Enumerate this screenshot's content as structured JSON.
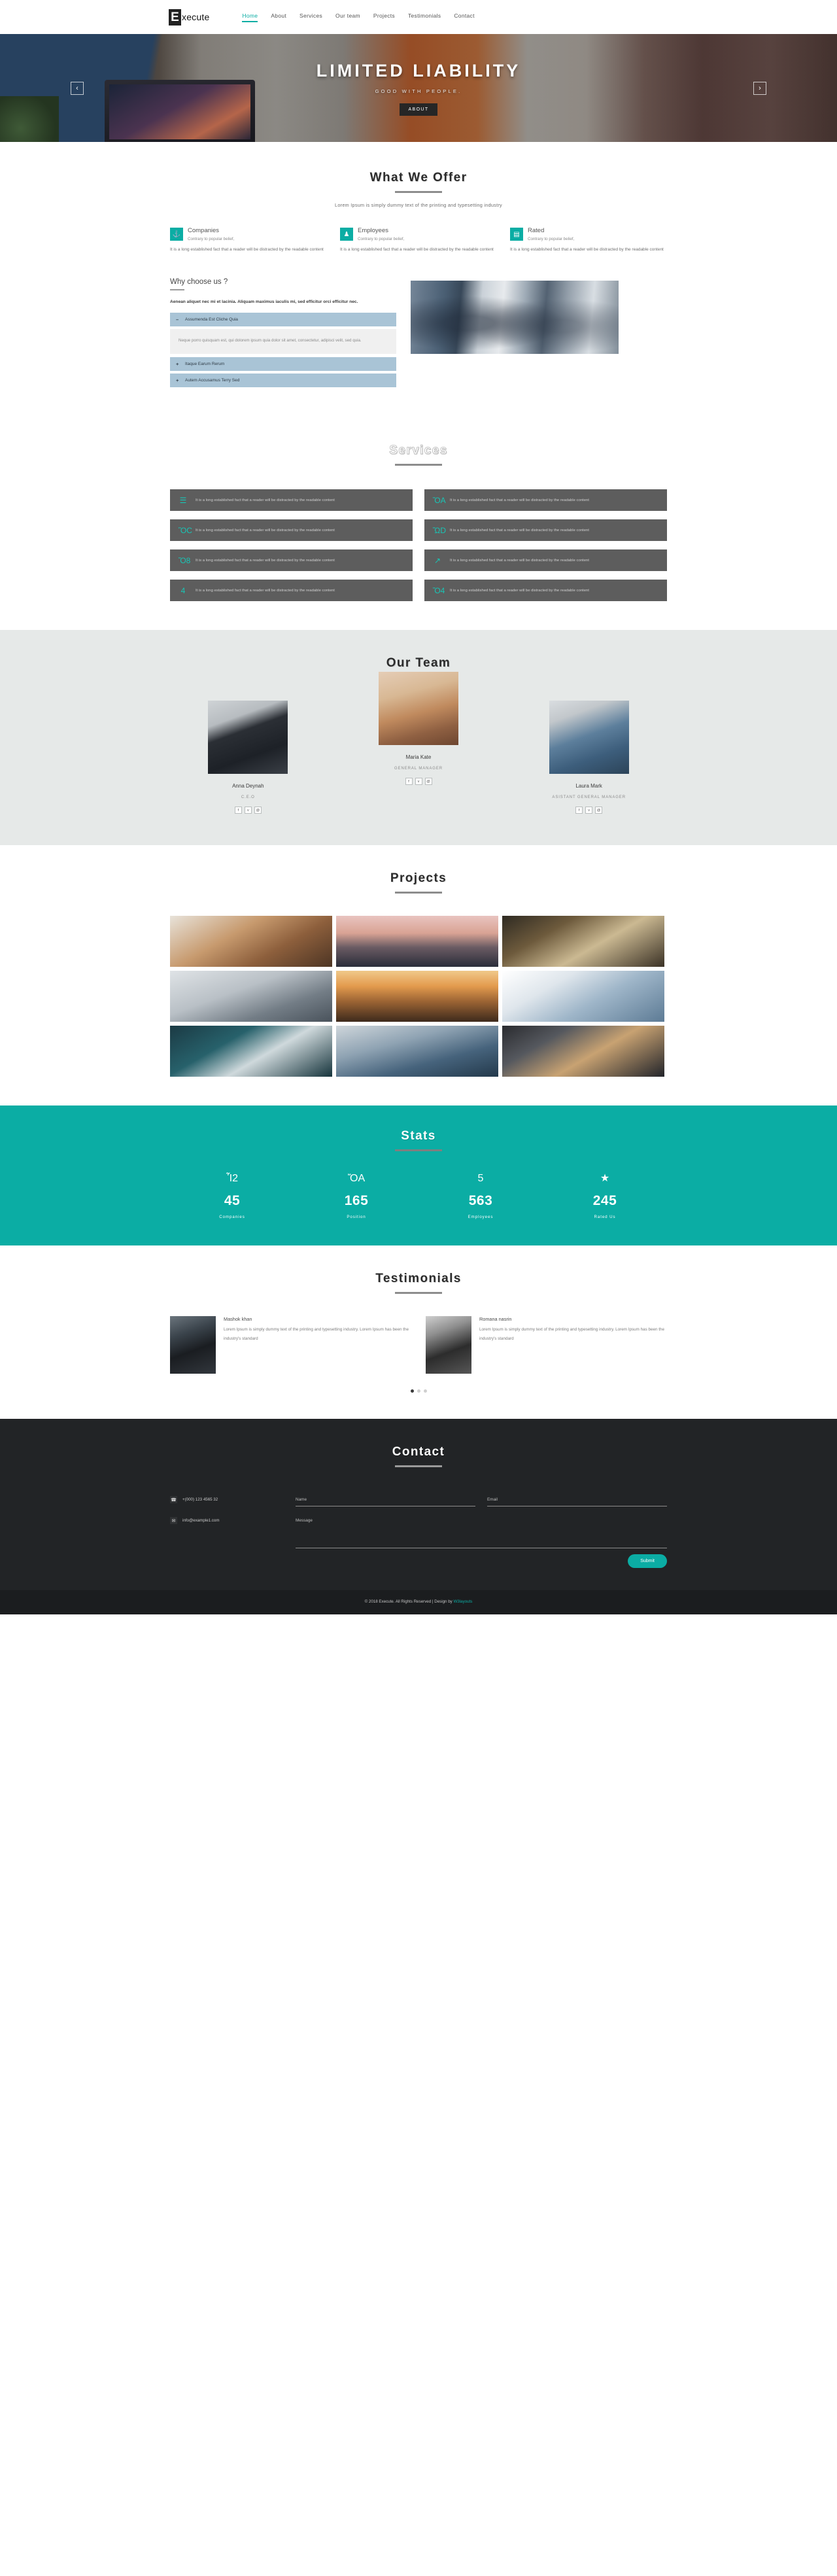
{
  "header": {
    "logo_mark": "E",
    "logo_text": "xecute",
    "nav": [
      {
        "label": "Home",
        "active": true
      },
      {
        "label": "About",
        "active": false
      },
      {
        "label": "Services",
        "active": false
      },
      {
        "label": "Our team",
        "active": false
      },
      {
        "label": "Projects",
        "active": false
      },
      {
        "label": "Testimonials",
        "active": false
      },
      {
        "label": "Contact",
        "active": false
      }
    ]
  },
  "hero": {
    "title": "LIMITED LIABILITY",
    "subtitle": "GOOD WITH PEOPLE.",
    "button": "ABOUT",
    "prev_icon": "‹",
    "next_icon": "›"
  },
  "offer": {
    "title": "What We Offer",
    "lead": "Lorem Ipsum is simply dummy text of the printing and typesetting industry",
    "cards": [
      {
        "icon": "⚓",
        "name": "Companies",
        "small": "Contrary to popular belief,",
        "body": "It is a long established fact that a reader will be distracted by the readable content"
      },
      {
        "icon": "♟",
        "name": "Employees",
        "small": "Contrary to popular belief,",
        "body": "It is a long established fact that a reader will be distracted by the readable content"
      },
      {
        "icon": "▤",
        "name": "Rated",
        "small": "Contrary to popular belief,",
        "body": "It is a long established fact that a reader will be distracted by the readable content"
      }
    ]
  },
  "why": {
    "title": "Why choose us ?",
    "lead": "Aenean aliquet nec mi et lacinia. Aliquam maximus iaculis mi, sed efficitur orci efficitur nec.",
    "items": [
      {
        "sign": "–",
        "label": "Assumenda Est Cliche Quia",
        "open": true,
        "panel": "Neque porro quisquam est, qui dolorem ipsum quia dolor sit amet, consectetur, adipisci velit, sed quia."
      },
      {
        "sign": "+",
        "label": "Itaque Earum Rerum",
        "open": false,
        "panel": ""
      },
      {
        "sign": "+",
        "label": "Autem Accusamus Terry Sed",
        "open": false,
        "panel": ""
      }
    ]
  },
  "services": {
    "title": "Services",
    "cards": [
      {
        "icon": "☰",
        "text": "It is a long established fact that a reader will be distracted by the readable content"
      },
      {
        "icon": "ὌA",
        "text": "It is a long established fact that a reader will be distracted by the readable content"
      },
      {
        "icon": "ὋC",
        "text": "It is a long established fact that a reader will be distracted by the readable content"
      },
      {
        "icon": "ὬD",
        "text": "It is a long established fact that a reader will be distracted by the readable content"
      },
      {
        "icon": "Ὄ8",
        "text": "It is a long established fact that a reader will be distracted by the readable content"
      },
      {
        "icon": "↗",
        "text": "It is a long established fact that a reader will be distracted by the readable content"
      },
      {
        "icon": "὆4",
        "text": "It is a long established fact that a reader will be distracted by the readable content"
      },
      {
        "icon": "Ὄ4",
        "text": "It is a long established fact that a reader will be distracted by the readable content"
      }
    ]
  },
  "team": {
    "title": "Our Team",
    "members": [
      {
        "name": "Anna Deynah",
        "role": "C.E.O"
      },
      {
        "name": "Maria Kate",
        "role": "GENERAL MANAGER"
      },
      {
        "name": "Laura Mark",
        "role": "ASISTANT GENERAL MANAGER"
      }
    ],
    "social": [
      "f",
      "ᴠ",
      "@"
    ]
  },
  "projects": {
    "title": "Projects"
  },
  "stats": {
    "title": "Stats",
    "items": [
      {
        "icon": "Ἶ2",
        "number": "45",
        "label": "Companies"
      },
      {
        "icon": "ὌA",
        "number": "165",
        "label": "Position"
      },
      {
        "icon": "὆5",
        "number": "563",
        "label": "Employees"
      },
      {
        "icon": "★",
        "number": "245",
        "label": "Rated Us"
      }
    ]
  },
  "testimonials": {
    "title": "Testimonials",
    "items": [
      {
        "name": "Mashok khan",
        "body": "Lorem Ipsum is simply dummy text of the printing and typesetting industry. Lorem Ipsum has been the industry's standard"
      },
      {
        "name": "Romana nasrin",
        "body": "Lorem Ipsum is simply dummy text of the printing and typesetting industry. Lorem Ipsum has been the industry's standard"
      }
    ],
    "dots": 3,
    "active_dot": 0
  },
  "contact": {
    "title": "Contact",
    "phone": "+(000) 123 4565 32",
    "email": "info@example1.com",
    "phone_icon": "☎",
    "email_icon": "✉",
    "name_placeholder": "Name",
    "email_placeholder": "Email",
    "message_placeholder": "Message",
    "name_value": "",
    "email_value": "",
    "message_value": "",
    "submit": "Submit"
  },
  "footer": {
    "copyright": "© 2018 Execute. All Rights Reserved | Design by ",
    "designer": "W3layouts"
  },
  "colors": {
    "accent": "#0BADA4",
    "dark": "#222426",
    "footer": "#1b1d1f",
    "team_bg": "#e6e9e8",
    "service_card": "#5d5d5d",
    "accordion": "#a9c4d6"
  }
}
